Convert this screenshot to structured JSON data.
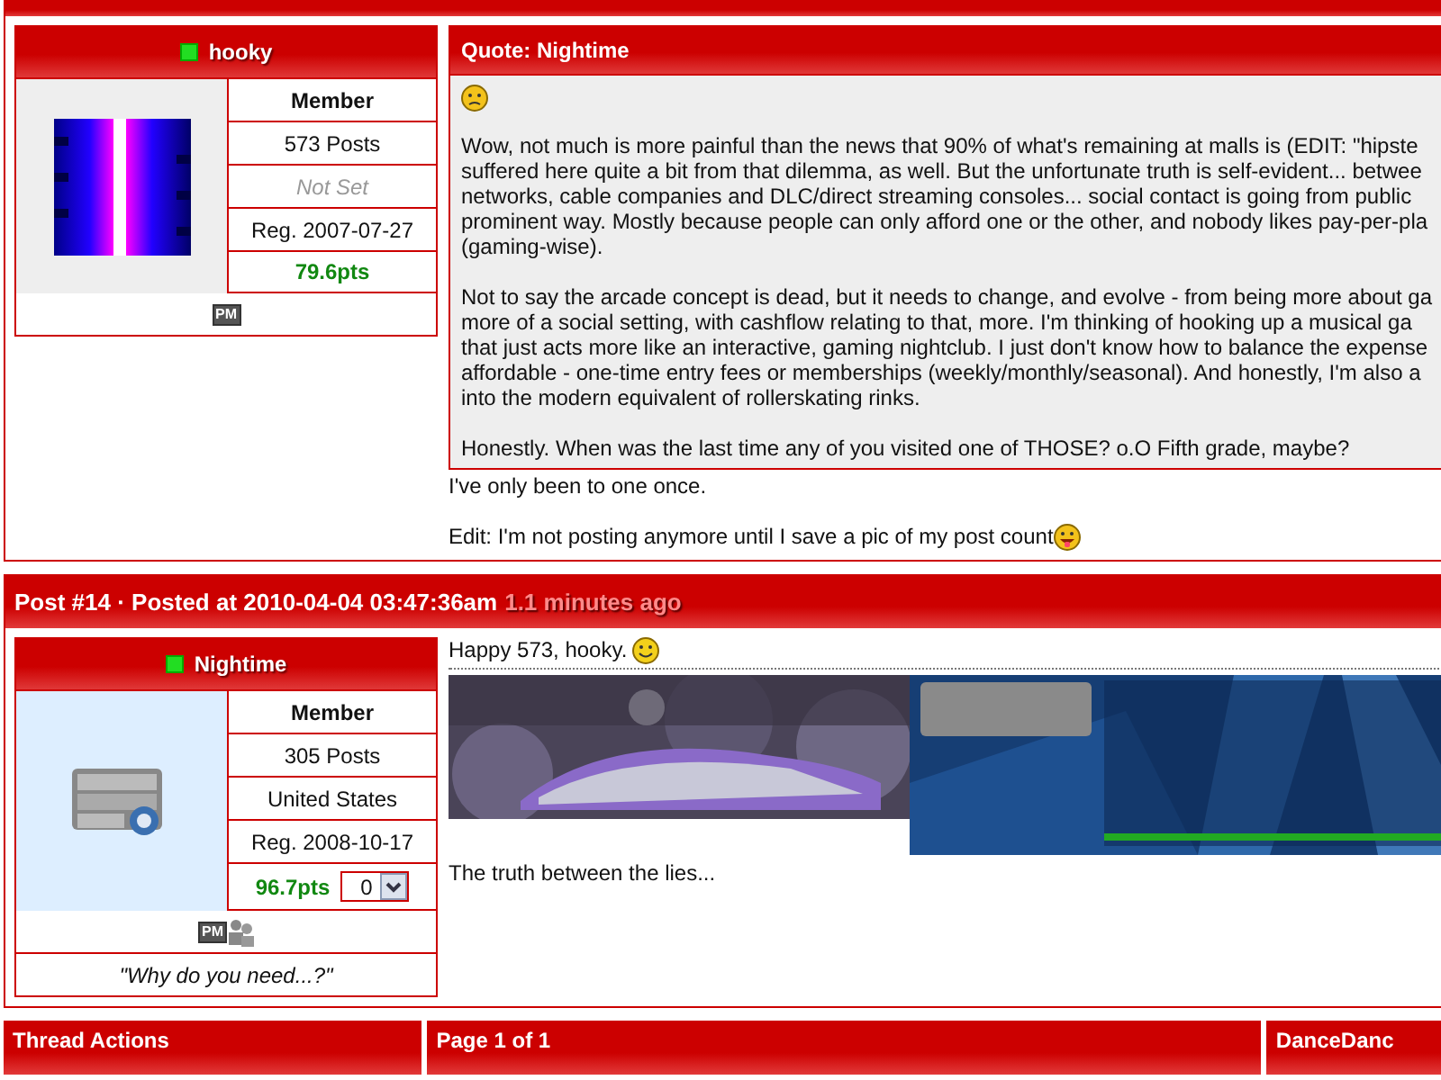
{
  "posts": [
    {
      "user": {
        "name": "hooky",
        "online": true,
        "rank": "Member",
        "posts": "573 Posts",
        "location": "Not Set",
        "location_set": false,
        "registered": "Reg. 2007-07-27",
        "points": "79.6pts",
        "contact": [
          {
            "kind": "pm",
            "label": "PM"
          }
        ]
      },
      "quote": {
        "title": "Quote: Nightime",
        "smiley": true,
        "paragraphs": [
          [
            "Wow, not much is more painful than the news that 90% of what's remaining at malls is (EDIT: \"hipste",
            "suffered here quite a bit from that dilemma, as well. But the unfortunate truth is self-evident... betwee",
            "networks, cable companies and DLC/direct streaming consoles... social contact is going from public",
            "prominent way. Mostly because people can only afford one or the other, and nobody likes pay-per-pla",
            "(gaming-wise)."
          ],
          [
            "Not to say the arcade concept is dead, but it needs to change, and evolve - from being more about ga",
            "more of a social setting, with cashflow relating to that, more. I'm thinking of hooking up a musical ga",
            "that just acts more like an interactive, gaming nightclub. I just don't know how to balance the expense",
            "affordable - one-time entry fees or memberships (weekly/monthly/seasonal). And honestly, I'm also a",
            "into the modern equivalent of rollerskating rinks."
          ],
          [
            "Honestly. When was the last time any of you visited one of THOSE? o.O Fifth grade, maybe?"
          ]
        ]
      },
      "body": [
        {
          "text": "I've only been to one once."
        },
        {
          "text": "Edit: I'm not posting anymore until I save a pic of my post count",
          "smiley": true
        }
      ]
    },
    {
      "title": {
        "text": "Post #14 · Posted at 2010-04-04 03:47:36am",
        "ago": "1.1 minutes ago"
      },
      "user": {
        "name": "Nightime",
        "online": true,
        "rank": "Member",
        "posts": "305 Posts",
        "location": "United States",
        "location_set": true,
        "registered": "Reg. 2008-10-17",
        "points": "96.7pts",
        "rating": "0",
        "contact": [
          {
            "kind": "pm",
            "label": "PM"
          },
          {
            "kind": "messenger"
          }
        ],
        "tagline": "\"Why do you need...?\""
      },
      "body": [
        {
          "text": "Happy 573, hooky.",
          "smiley": true
        }
      ],
      "signature": {
        "text": "The truth between the lies..."
      }
    }
  ],
  "footer": [
    {
      "title": "Thread Actions"
    },
    {
      "title": "Page 1 of 1"
    },
    {
      "title": "DanceDanc"
    }
  ]
}
